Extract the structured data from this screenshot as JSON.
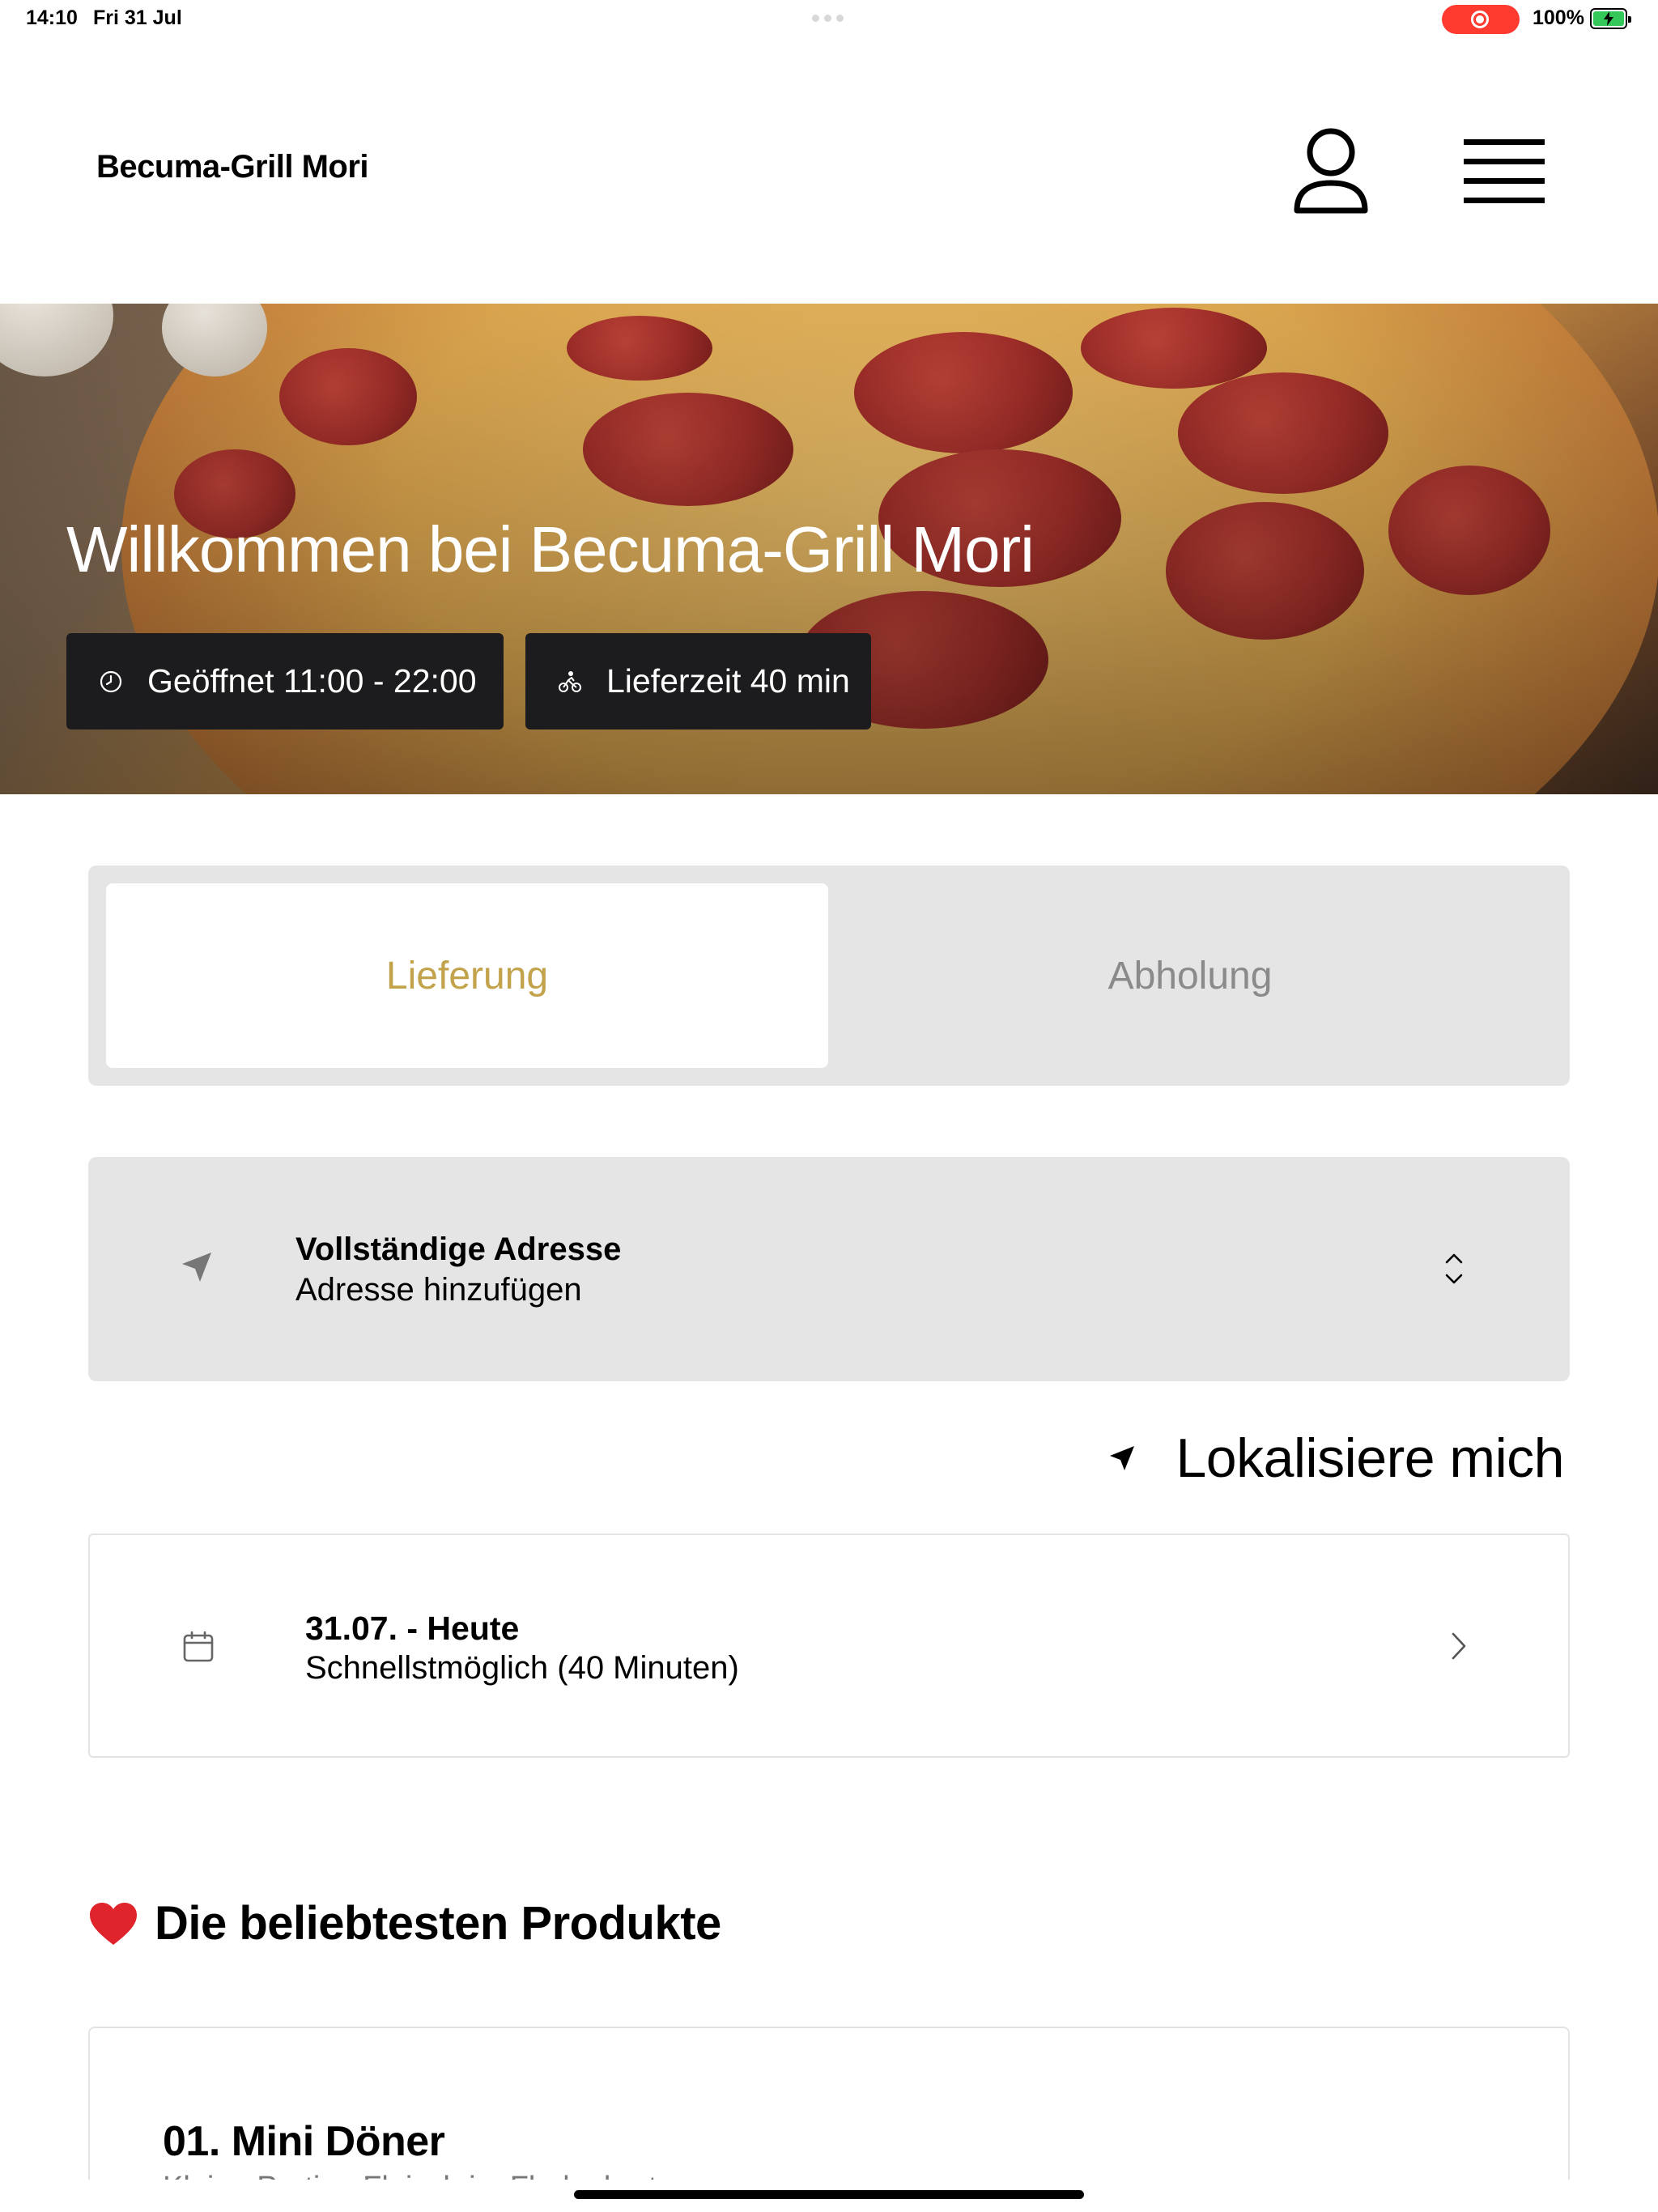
{
  "status_bar": {
    "time": "14:10",
    "date": "Fri 31 Jul",
    "battery": "100%",
    "recording_color": "#ff3b30",
    "battery_color": "#34c759"
  },
  "header": {
    "brand": "Becuma-Grill Mori",
    "user_icon": "user-icon",
    "menu_icon": "hamburger-menu-icon"
  },
  "hero": {
    "title": "Willkommen bei Becuma-Grill Mori",
    "opening_hours": "Geöffnet 11:00 - 22:00",
    "delivery_time": "Lieferzeit 40 min",
    "clock_icon": "clock-icon",
    "delivery_icon": "bicycle-icon"
  },
  "order_mode": {
    "options": [
      "Lieferung",
      "Abholung"
    ],
    "selected": "Lieferung",
    "accent_color": "#c2a24a"
  },
  "address": {
    "title": "Vollständige Adresse",
    "placeholder": "Adresse hinzufügen",
    "icon": "navigation-arrow-icon"
  },
  "locate": {
    "label": "Lokalisiere mich",
    "icon": "location-arrow-icon"
  },
  "schedule": {
    "date": "31.07. - Heute",
    "time": "Schnellstmöglich (40 Minuten)",
    "icon": "calendar-icon"
  },
  "popular": {
    "title": "Die beliebtesten Produkte",
    "icon": "heart-icon",
    "products": [
      {
        "name": "01. Mini Döner",
        "description": "Kleine Portion Fleisch im Fladenbrot"
      }
    ]
  }
}
